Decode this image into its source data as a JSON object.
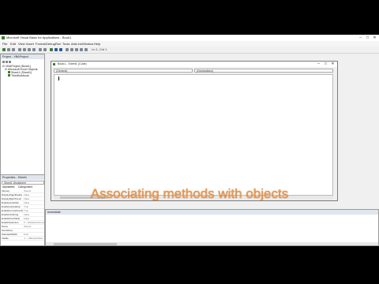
{
  "window": {
    "title": "Microsoft Visual Basic for Applications - Book1",
    "minimize": "–",
    "maximize": "□",
    "close": "✕"
  },
  "menu": [
    "File",
    "Edit",
    "View",
    "Insert",
    "Format",
    "Debug",
    "Run",
    "Tools",
    "Add-Ins",
    "Window",
    "Help"
  ],
  "toolbar": {
    "position": "Ln 1, Col 1"
  },
  "project": {
    "header": "Project - VBAProject",
    "items": [
      "VBAProject (Book1)",
      "Microsoft Excel Objects",
      "Sheet1 (Sheet1)",
      "ThisWorkbook"
    ]
  },
  "properties": {
    "header": "Properties - Sheet1",
    "object": "Sheet1 Worksheet",
    "tabs": [
      "Alphabetic",
      "Categorized"
    ],
    "rows": [
      {
        "k": "(Name)",
        "v": "Sheet1"
      },
      {
        "k": "DisplayPageBreaks",
        "v": "False"
      },
      {
        "k": "DisplayRightToLeft",
        "v": "False"
      },
      {
        "k": "EnableAutoFilter",
        "v": "False"
      },
      {
        "k": "EnableCalculation",
        "v": "True"
      },
      {
        "k": "EnableFormatConditions",
        "v": "True"
      },
      {
        "k": "EnableOutlining",
        "v": "False"
      },
      {
        "k": "EnablePivotTable",
        "v": "False"
      },
      {
        "k": "EnableSelection",
        "v": "0 - xlNoRestrictions"
      },
      {
        "k": "Name",
        "v": "Sheet1"
      },
      {
        "k": "ScrollArea",
        "v": ""
      },
      {
        "k": "StandardWidth",
        "v": "8.43"
      },
      {
        "k": "Visible",
        "v": "-1 - xlSheetVisible"
      }
    ]
  },
  "code": {
    "title": "Book1 - Sheet1 (Code)",
    "object_combo": "(General)",
    "proc_combo": "(Declarations)"
  },
  "immediate": {
    "header": "Immediate"
  },
  "caption": "Associating methods with objects",
  "colors": {
    "caption": "#f39a4a",
    "background": "#000000",
    "ide": "#f0f0f0"
  }
}
